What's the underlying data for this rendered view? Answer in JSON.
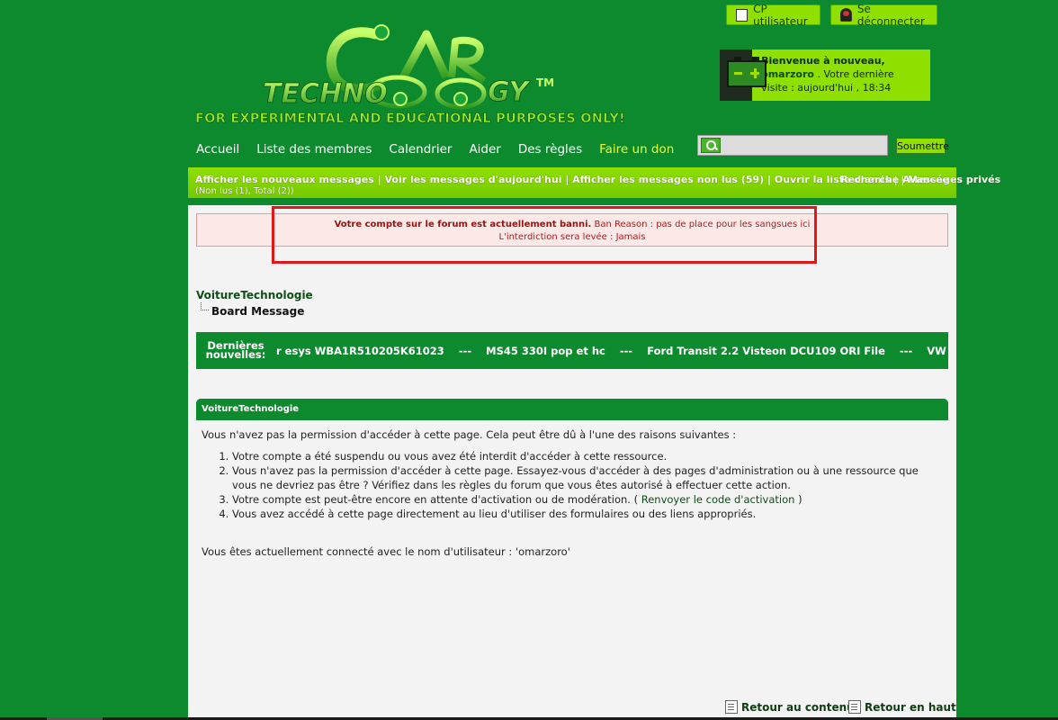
{
  "header": {
    "cp_button": "CP utilisateur",
    "logout_button": "Se déconnecter",
    "tagline": "FOR EXPERIMENTAL AND EDUCATIONAL PURPOSES ONLY!"
  },
  "welcome": {
    "greeting": "Bienvenue à nouveau,",
    "username": "omarzoro",
    "last_visit": " . Votre dernière visite : aujourd'hui , 18:34"
  },
  "nav": {
    "items": [
      "Accueil",
      "Liste des membres",
      "Calendrier",
      "Aider",
      "Des règles",
      "Faire un don"
    ]
  },
  "search": {
    "placeholder": "",
    "submit_label": "Soumettre"
  },
  "quickbar": {
    "links": "Afficher les nouveaux messages | Voir les messages d'aujourd'hui | Afficher les messages non lus (59) | Ouvrir la liste d'amis | | Messages privés",
    "advanced": "Recherche Avancée",
    "pm_counts": "(Non lus (1), Total (2))"
  },
  "ban": {
    "title": "Votre compte sur le forum est actuellement banni.",
    "reason": " Ban Reason : pas de place pour les sangsues ici",
    "lifted": "L'interdiction sera levée : Jamais"
  },
  "breadcrumb": {
    "root": "VoitureTechnologie",
    "current": "Board Message"
  },
  "news": {
    "label": "Dernières nouvelles:",
    "ticker": "r esys WBA1R510205K61023    ---    MS45 330I pop et hc    ---    Ford Transit 2.2 Visteon DCU109 ORI File    ---    VW Transporter"
  },
  "panel": {
    "title": "VoitureTechnologie",
    "intro": "Vous n'avez pas la permission d'accéder à cette page. Cela peut être dû à l'une des raisons suivantes :",
    "reason1": "Votre compte a été suspendu ou vous avez été interdit d'accéder à cette ressource.",
    "reason2": "Vous n'avez pas la permission d'accéder à cette page. Essayez-vous d'accéder à des pages d'administration ou à une ressource que vous ne devriez pas être ? Vérifiez dans les règles du forum que vous êtes autorisé à effectuer cette action.",
    "reason3_pre": "Votre compte est peut-être encore en attente d'activation ou de modération. ( ",
    "reason3_link": "Renvoyer le code d'activation",
    "reason3_post": " )",
    "reason4": "Vous avez accédé à cette page directement au lieu d'utiliser des formulaires ou des liens appropriés.",
    "connected": "Vous êtes actuellement connecté avec le nom d'utilisateur : 'omarzoro'"
  },
  "footer": {
    "back_content": "Retour au contenu",
    "back_top": "Retour en haut"
  }
}
